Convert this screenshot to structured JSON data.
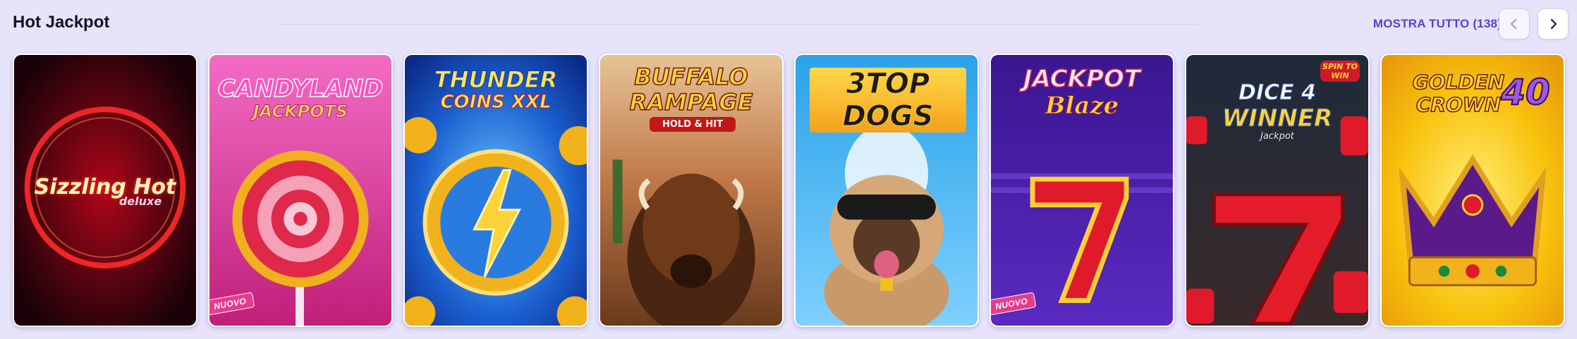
{
  "section": {
    "title": "Hot Jackpot",
    "show_all_label": "MOSTRA TUTTO (138)"
  },
  "nav": {
    "prev_icon": "chevron-left-icon",
    "next_icon": "chevron-right-icon"
  },
  "games": [
    {
      "name": "Sizzling Hot deluxe",
      "logo": "Sizzling Hot",
      "logo_sub": "deluxe",
      "badge": ""
    },
    {
      "name": "Candyland Jackpots",
      "logo": "CANDYLAND",
      "logo_sub": "JACKPOTS",
      "badge": "NUOVO"
    },
    {
      "name": "Thunder Coins XXL",
      "logo": "THUNDER",
      "logo_sub": "COINS XXL",
      "badge": ""
    },
    {
      "name": "Buffalo Rampage Hold & Hit",
      "logo": "BUFFALO",
      "logo_sub": "RAMPAGE",
      "logo_sub2": "HOLD & HIT",
      "badge": ""
    },
    {
      "name": "3 Top Dogs",
      "logo": "3TOP DOGS",
      "badge": ""
    },
    {
      "name": "Jackpot Blaze",
      "logo": "JACKPOT",
      "logo_sub": "Blaze",
      "badge": "NUOVO"
    },
    {
      "name": "Dice 4 Winner Jackpot",
      "logo": "DICE 4",
      "logo_sub": "WINNER",
      "logo_sub2": "Jackpot",
      "logo_sub3": "SPIN TO WIN",
      "badge": ""
    },
    {
      "name": "Golden Crown 40",
      "logo": "GOLDEN",
      "logo_sub": "CROWN",
      "logo_num": "40",
      "badge": ""
    }
  ],
  "colors": {
    "background": "#e6e3fa",
    "accent": "#5a40d6",
    "badge": "#e83a8e"
  }
}
